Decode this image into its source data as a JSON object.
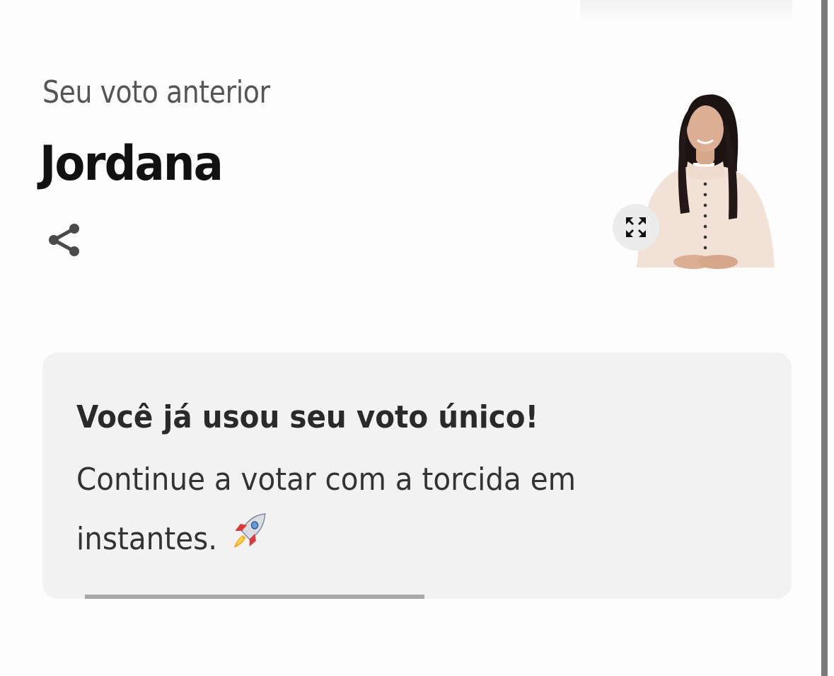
{
  "previous_vote": {
    "label": "Seu voto anterior",
    "name": "Jordana"
  },
  "icons": {
    "share": "share-icon",
    "expand": "expand-icon",
    "rocket": "rocket-icon"
  },
  "notice": {
    "title": "Você já usou seu voto único!",
    "body": "Continue a votar com a torcida em instantes.",
    "progress": 0.4
  },
  "colors": {
    "card_background": "#f2f2f2",
    "progress": "#a8a8a8",
    "text_dark": "#111111"
  }
}
